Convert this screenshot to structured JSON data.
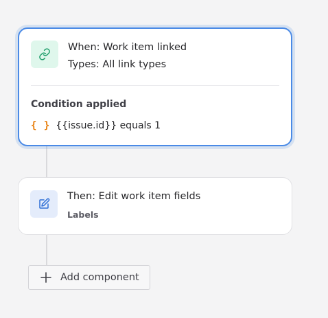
{
  "trigger": {
    "icon": "link-icon",
    "title": "When: Work item linked",
    "subtitle": "Types: All link types",
    "condition_title": "Condition applied",
    "condition_icon": "{ }",
    "condition_text": "{{issue.id}} equals 1",
    "accent_color": "#4a8ae6"
  },
  "action": {
    "icon": "edit-icon",
    "title": "Then: Edit work item fields",
    "subtitle": "Labels"
  },
  "add_component": {
    "icon": "plus-icon",
    "label": "Add component"
  }
}
